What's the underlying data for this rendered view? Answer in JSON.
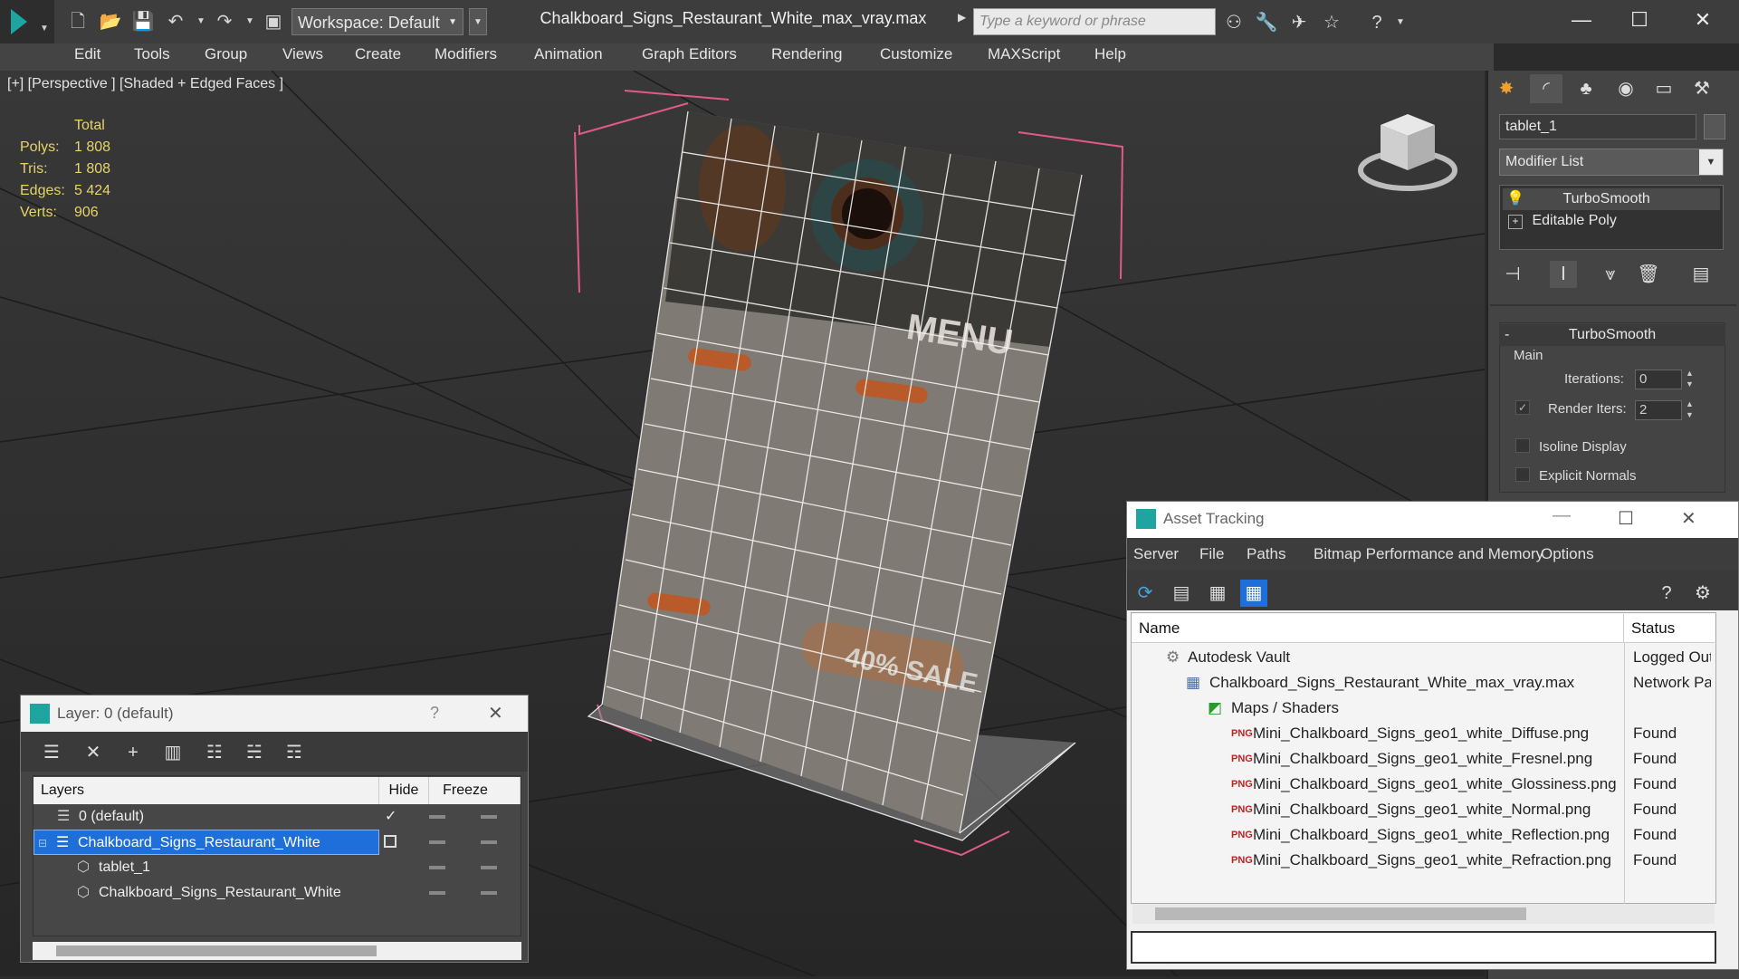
{
  "app": {
    "file_title": "Chalkboard_Signs_Restaurant_White_max_vray.max",
    "workspace": "Workspace: Default",
    "search_placeholder": "Type a keyword or phrase",
    "menu": [
      "Edit",
      "Tools",
      "Group",
      "Views",
      "Create",
      "Modifiers",
      "Animation",
      "Graph Editors",
      "Rendering",
      "Customize",
      "MAXScript",
      "Help"
    ]
  },
  "viewport": {
    "label": "[+] [Perspective ] [Shaded + Edged Faces ]",
    "stats_header": "Total",
    "stats": [
      {
        "label": "Polys:",
        "value": "1 808"
      },
      {
        "label": "Tris:",
        "value": "1 808"
      },
      {
        "label": "Edges:",
        "value": "5 424"
      },
      {
        "label": "Verts:",
        "value": "906"
      }
    ],
    "sign_text": {
      "menu": "MENU",
      "sale": "40% SALE"
    }
  },
  "command_panel": {
    "object_name": "tablet_1",
    "modifier_list": "Modifier List",
    "stack": [
      "TurboSmooth",
      "Editable Poly"
    ],
    "rollout_title": "TurboSmooth",
    "group_main": "Main",
    "iterations_label": "Iterations:",
    "iterations_value": "0",
    "render_iters_label": "Render Iters:",
    "render_iters_value": "2",
    "isoline_label": "Isoline Display",
    "explicit_normals_label": "Explicit Normals"
  },
  "asset_tracking": {
    "title": "Asset Tracking",
    "menu": [
      "Server",
      "File",
      "Paths",
      "Bitmap Performance and Memory",
      "Options"
    ],
    "col_name": "Name",
    "col_status": "Status",
    "rows": [
      {
        "name": "Autodesk Vault",
        "status": "Logged Out",
        "indent": 1,
        "icon": "vault-icon"
      },
      {
        "name": "Chalkboard_Signs_Restaurant_White_max_vray.max",
        "status": "Network Pat",
        "indent": 2,
        "icon": "max-file-icon"
      },
      {
        "name": "Maps / Shaders",
        "status": "",
        "indent": 3,
        "icon": "maps-icon"
      },
      {
        "name": "Mini_Chalkboard_Signs_geo1_white_Diffuse.png",
        "status": "Found",
        "indent": 4,
        "icon": "png-icon"
      },
      {
        "name": "Mini_Chalkboard_Signs_geo1_white_Fresnel.png",
        "status": "Found",
        "indent": 4,
        "icon": "png-icon"
      },
      {
        "name": "Mini_Chalkboard_Signs_geo1_white_Glossiness.png",
        "status": "Found",
        "indent": 4,
        "icon": "png-icon"
      },
      {
        "name": "Mini_Chalkboard_Signs_geo1_white_Normal.png",
        "status": "Found",
        "indent": 4,
        "icon": "png-icon"
      },
      {
        "name": "Mini_Chalkboard_Signs_geo1_white_Reflection.png",
        "status": "Found",
        "indent": 4,
        "icon": "png-icon"
      },
      {
        "name": "Mini_Chalkboard_Signs_geo1_white_Refraction.png",
        "status": "Found",
        "indent": 4,
        "icon": "png-icon"
      }
    ]
  },
  "layer_window": {
    "title": "Layer: 0 (default)",
    "help": "?",
    "col_layers": "Layers",
    "col_hide": "Hide",
    "col_freeze": "Freeze",
    "rows": [
      {
        "name": "0 (default)",
        "indent": 1,
        "selected": false
      },
      {
        "name": "Chalkboard_Signs_Restaurant_White",
        "indent": 1,
        "selected": true
      },
      {
        "name": "tablet_1",
        "indent": 2,
        "selected": false
      },
      {
        "name": "Chalkboard_Signs_Restaurant_White",
        "indent": 2,
        "selected": false
      }
    ]
  },
  "colors": {
    "selection_blue": "#1e6fd9",
    "stat_yellow": "#e6d36a",
    "bbox_pink": "#e05a8a",
    "accent_teal": "#1fa5a0"
  }
}
